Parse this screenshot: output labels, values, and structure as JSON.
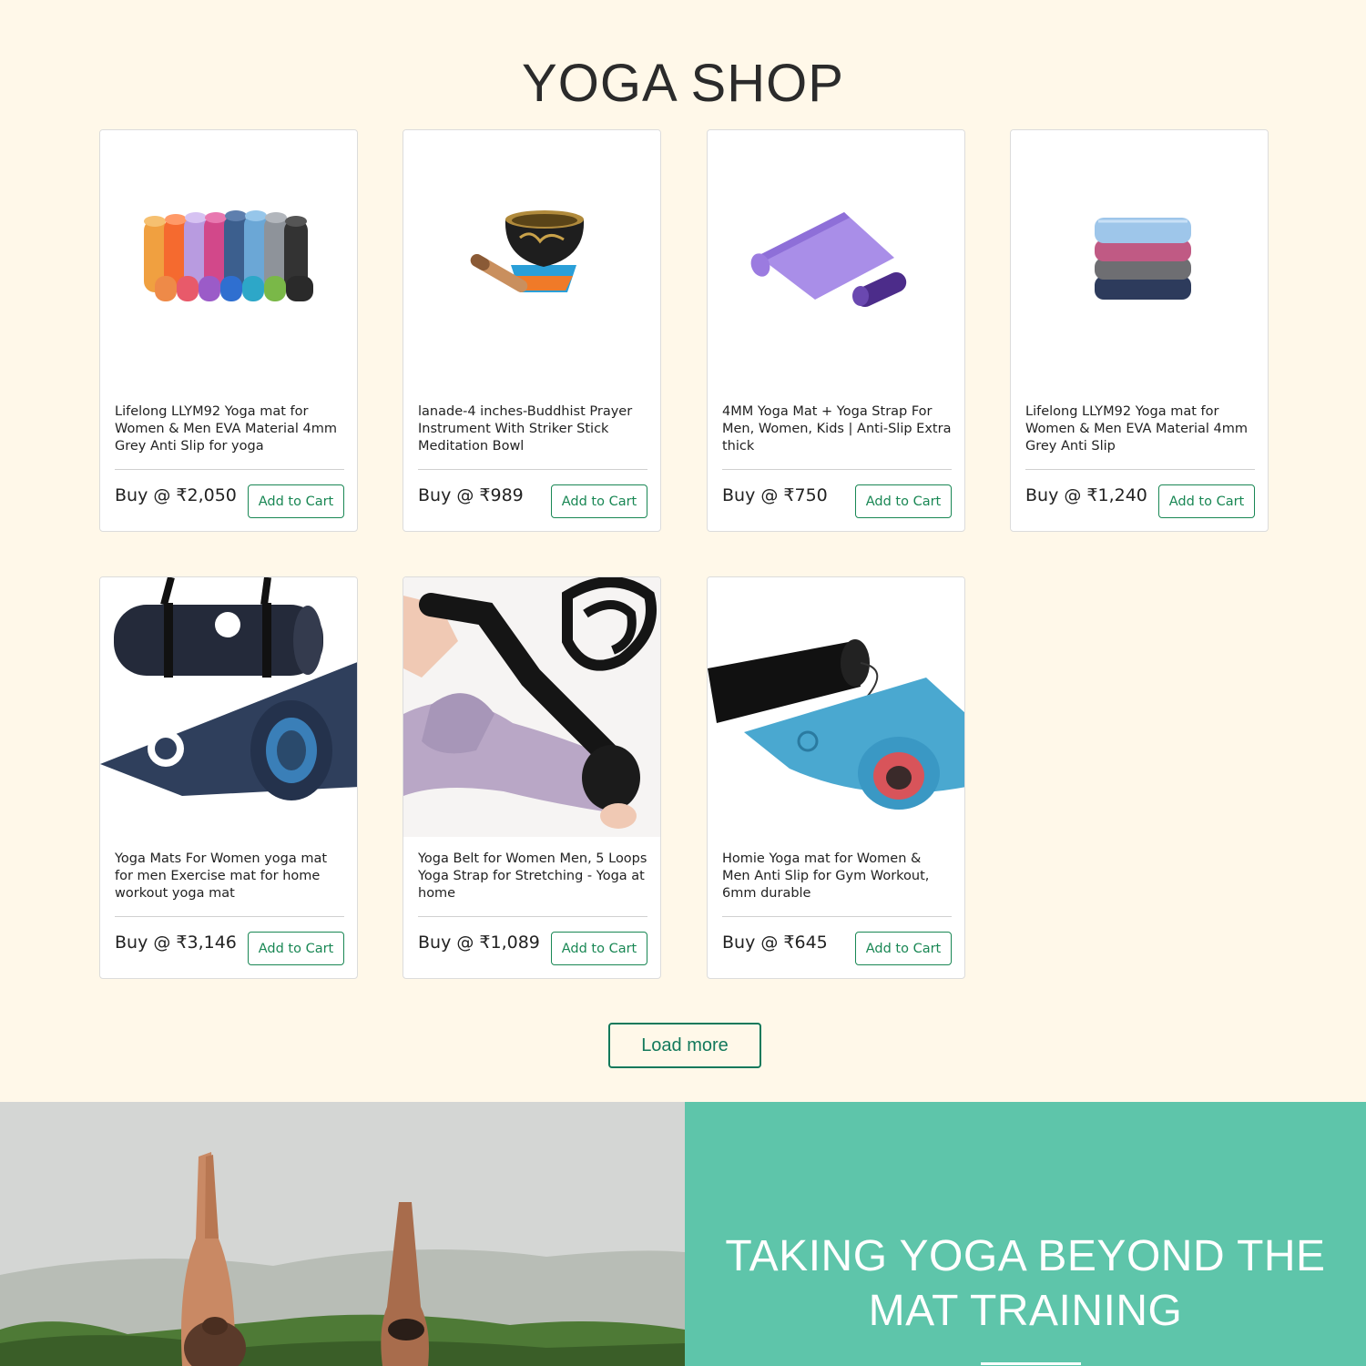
{
  "shop": {
    "title": "YOGA SHOP",
    "load_more_label": "Load more"
  },
  "products": [
    {
      "name": "Lifelong LLYM92 Yoga mat for Women & Men EVA Material 4mm Grey Anti Slip for yoga",
      "price": "Buy @ ₹2,050",
      "cart_label": "Add to Cart",
      "image": "colorful-yoga-mats-image"
    },
    {
      "name": "lanade-4 inches-Buddhist Prayer Instrument With Striker Stick Meditation Bowl",
      "price": "Buy @ ₹989",
      "cart_label": "Add to Cart",
      "image": "singing-bowl-image"
    },
    {
      "name": "4MM Yoga Mat + Yoga Strap For Men, Women, Kids | Anti-Slip Extra thick",
      "price": "Buy @ ₹750",
      "cart_label": "Add to Cart",
      "image": "purple-yoga-mat-image"
    },
    {
      "name": "Lifelong LLYM92 Yoga mat for Women & Men EVA Material 4mm Grey Anti Slip",
      "price": "Buy @ ₹1,240",
      "cart_label": "Add to Cart",
      "image": "folded-yoga-towels-image"
    },
    {
      "name": "Yoga Mats For Women yoga mat for men Exercise mat for home workout yoga mat",
      "price": "Buy @ ₹3,146",
      "cart_label": "Add to Cart",
      "image": "navy-yoga-mat-image"
    },
    {
      "name": "Yoga Belt for Women Men, 5 Loops Yoga Strap for Stretching - Yoga at home",
      "price": "Buy @ ₹1,089",
      "cart_label": "Add to Cart",
      "image": "yoga-strap-image"
    },
    {
      "name": "Homie Yoga mat for Women & Men Anti Slip for Gym Workout, 6mm durable",
      "price": "Buy @ ₹645",
      "cart_label": "Add to Cart",
      "image": "blue-yoga-mat-with-bag-image"
    }
  ],
  "banner": {
    "heading_line1": "TAKING YOGA BEYOND THE",
    "heading_line2": "MAT TRAINING",
    "image": "outdoor-yoga-photo"
  },
  "colors": {
    "page_background": "#fff8e9",
    "accent_green": "#198754",
    "banner_teal": "#5ec5aa"
  }
}
